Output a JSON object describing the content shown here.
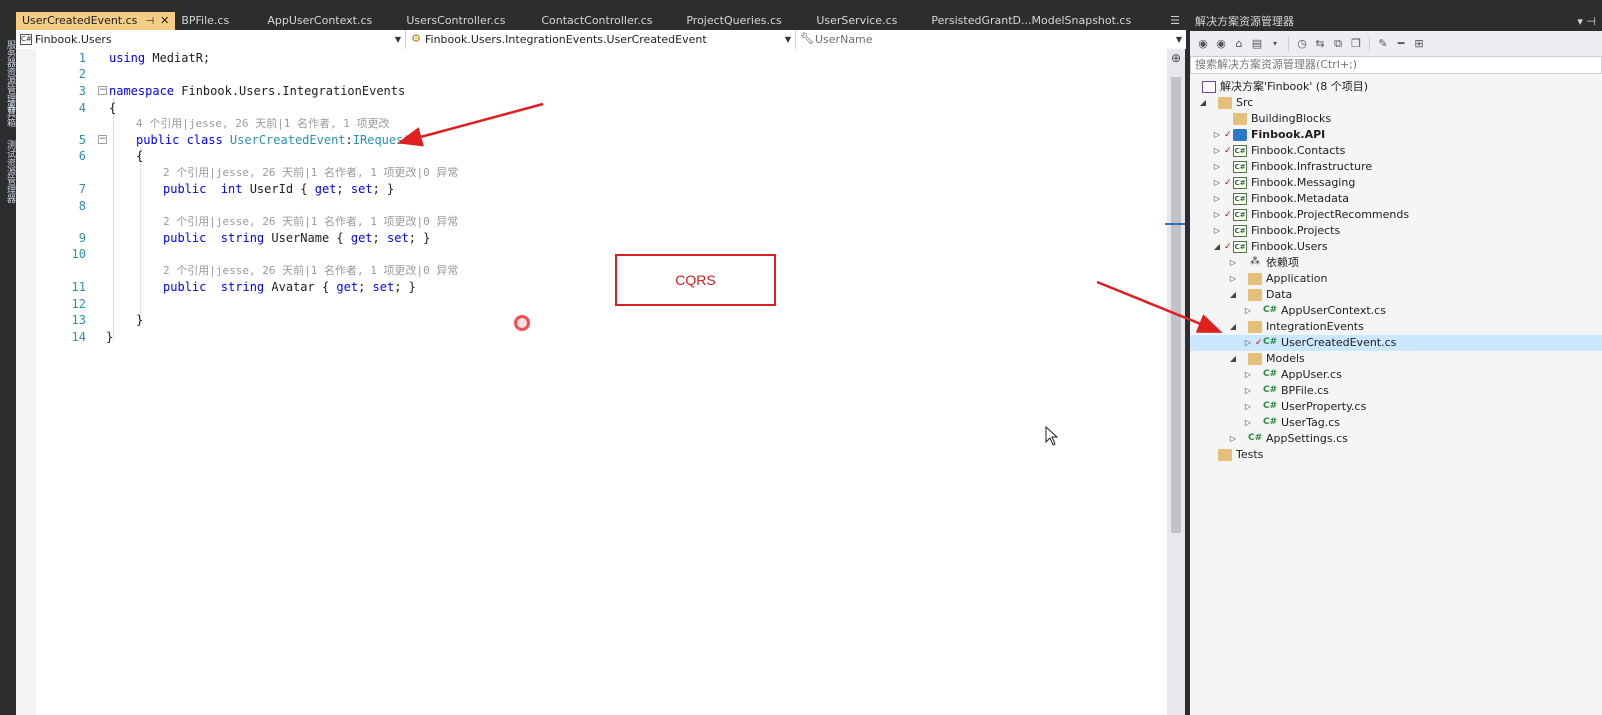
{
  "left_strip": {
    "vertical_tabs": [
      "服务器资源管理器",
      "工具箱",
      "测试资源管理器"
    ]
  },
  "tabs": [
    {
      "label": "UserCreatedEvent.cs",
      "active": true
    },
    {
      "label": "BPFile.cs",
      "active": false
    },
    {
      "label": "AppUserContext.cs",
      "active": false
    },
    {
      "label": "UsersController.cs",
      "active": false
    },
    {
      "label": "ContactController.cs",
      "active": false
    },
    {
      "label": "ProjectQueries.cs",
      "active": false
    },
    {
      "label": "UserService.cs",
      "active": false
    },
    {
      "label": "PersistedGrantD...ModelSnapshot.cs",
      "active": false
    }
  ],
  "tab_icons": {
    "pin": "pin-icon",
    "close": "close-icon",
    "overflow": "tab-overflow-icon"
  },
  "navbar": {
    "project": "Finbook.Users",
    "type": "Finbook.Users.IntegrationEvents.UserCreatedEvent",
    "member": "UserName"
  },
  "editor": {
    "line_numbers": [
      "1",
      "2",
      "3",
      "4",
      "5",
      "6",
      "7",
      "8",
      "9",
      "10",
      "11",
      "12",
      "13",
      "14"
    ],
    "code": {
      "l1_kw": "using",
      "l1_rest": " MediatR;",
      "l3_kw": "namespace",
      "l3_rest": " Finbook.Users.IntegrationEvents",
      "l4": "{",
      "lens_class": "4 个引用|jesse, 26 天前|1 名作者, 1 项更改",
      "l5_kw": "public class",
      "l5_type": " UserCreatedEvent",
      "l5_colon": ":",
      "l5_iface": "IRequest",
      "l6": "{",
      "lens_userid": "2 个引用|jesse, 26 天前|1 名作者, 1 项更改|0 异常",
      "l7_kw": "public",
      "l7_type_kw": "  int",
      "l7_rest": " UserId { ",
      "l7_get": "get",
      "l7_sep": "; ",
      "l7_set": "set",
      "l7_end": "; }",
      "lens_username": "2 个引用|jesse, 26 天前|1 名作者, 1 项更改|0 异常",
      "l9_kw": "public",
      "l9_type_kw": "  string",
      "l9_rest": " UserName { ",
      "l9_get": "get",
      "l9_sep": "; ",
      "l9_set": "set",
      "l9_end": "; }",
      "lens_avatar": "2 个引用|jesse, 26 天前|1 名作者, 1 项更改|0 异常",
      "l11_kw": "public",
      "l11_type_kw": "  string",
      "l11_rest": " Avatar { ",
      "l11_get": "get",
      "l11_sep": "; ",
      "l11_set": "set",
      "l11_end": "; }",
      "l13": "}",
      "l14": "}"
    },
    "fold_symbol": "−"
  },
  "annotation": {
    "cqrs_label": "CQRS",
    "arrow_color": "#e02020"
  },
  "solution_explorer": {
    "title": "解决方案资源管理器",
    "title_buttons": "▾ ⊣",
    "search_placeholder": "搜索解决方案资源管理器(Ctrl+;)",
    "toolbar_icons": [
      "back-icon",
      "forward-icon",
      "home-icon",
      "switch-views-icon",
      "history-icon",
      "sync-icon",
      "collapse-all-icon",
      "show-all-files-icon",
      "properties-icon",
      "preview-icon",
      "class-view-icon"
    ],
    "tree": [
      {
        "label": "解决方案'Finbook' (8 个项目)",
        "icon": "solution-icon",
        "arrow": ""
      },
      {
        "label": "Src",
        "icon": "folder-icon",
        "arrow": "◢"
      },
      {
        "label": "BuildingBlocks",
        "icon": "folder-icon",
        "arrow": ""
      },
      {
        "label": "Finbook.API",
        "icon": "api-project-icon",
        "arrow": "▷",
        "check": "✓",
        "bold": true
      },
      {
        "label": "Finbook.Contacts",
        "icon": "csharp-project-icon",
        "arrow": "▷",
        "check": "✓"
      },
      {
        "label": "Finbook.Infrastructure",
        "icon": "csharp-project-icon",
        "arrow": "▷"
      },
      {
        "label": "Finbook.Messaging",
        "icon": "csharp-project-icon",
        "arrow": "▷",
        "check": "✓"
      },
      {
        "label": "Finbook.Metadata",
        "icon": "csharp-project-icon",
        "arrow": "▷"
      },
      {
        "label": "Finbook.ProjectRecommends",
        "icon": "csharp-project-icon",
        "arrow": "▷",
        "check": "✓"
      },
      {
        "label": "Finbook.Projects",
        "icon": "csharp-project-icon",
        "arrow": "▷"
      },
      {
        "label": "Finbook.Users",
        "icon": "csharp-project-icon",
        "arrow": "◢",
        "check": "✓"
      },
      {
        "label": "依赖项",
        "icon": "dependencies-icon",
        "arrow": "▷"
      },
      {
        "label": "Application",
        "icon": "folder-icon",
        "arrow": "▷"
      },
      {
        "label": "Data",
        "icon": "folder-icon",
        "arrow": "◢"
      },
      {
        "label": "AppUserContext.cs",
        "icon": "csharp-file-icon",
        "arrow": "▷"
      },
      {
        "label": "IntegrationEvents",
        "icon": "folder-icon",
        "arrow": "◢"
      },
      {
        "label": "UserCreatedEvent.cs",
        "icon": "csharp-file-icon",
        "arrow": "▷",
        "check": "✓",
        "selected": true
      },
      {
        "label": "Models",
        "icon": "folder-icon",
        "arrow": "◢"
      },
      {
        "label": "AppUser.cs",
        "icon": "csharp-file-icon",
        "arrow": "▷"
      },
      {
        "label": "BPFile.cs",
        "icon": "csharp-file-icon",
        "arrow": "▷"
      },
      {
        "label": "UserProperty.cs",
        "icon": "csharp-file-icon",
        "arrow": "▷"
      },
      {
        "label": "UserTag.cs",
        "icon": "csharp-file-icon",
        "arrow": "▷"
      },
      {
        "label": "AppSettings.cs",
        "icon": "csharp-file-icon",
        "arrow": "▷"
      },
      {
        "label": "Tests",
        "icon": "folder-icon",
        "arrow": ""
      }
    ]
  }
}
